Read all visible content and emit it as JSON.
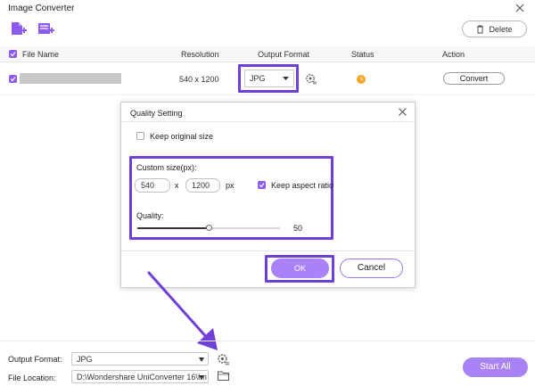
{
  "window": {
    "title": "Image Converter"
  },
  "toolbar": {
    "add_file_icon": "add-file-icon",
    "add_folder_icon": "add-folder-icon",
    "delete_label": "Delete"
  },
  "table": {
    "headers": {
      "file_name": "File Name",
      "resolution": "Resolution",
      "output_format": "Output Format",
      "status": "Status",
      "action": "Action"
    },
    "rows": [
      {
        "resolution": "540 x 1200",
        "format": "JPG",
        "action": "Convert",
        "checked": true
      }
    ]
  },
  "dialog": {
    "title": "Quality Setting",
    "keep_original_label": "Keep original size",
    "custom_size_label": "Custom size(px):",
    "width": "540",
    "times": "x",
    "height": "1200",
    "unit": "px",
    "keep_aspect_label": "Keep aspect ratio",
    "quality_label": "Quality:",
    "quality_value": "50",
    "quality_fraction": 0.5,
    "ok_label": "OK",
    "cancel_label": "Cancel"
  },
  "footer": {
    "output_format_label": "Output Format:",
    "output_format_value": "JPG",
    "file_location_label": "File Location:",
    "file_location_value": "D:\\Wondershare UniConverter 16\\Im",
    "start_all_label": "Start All"
  },
  "colors": {
    "accent": "#8c5cf2",
    "highlight": "#6f3fd9",
    "button_fill": "#a982f7",
    "status_orange": "#f5a623"
  }
}
